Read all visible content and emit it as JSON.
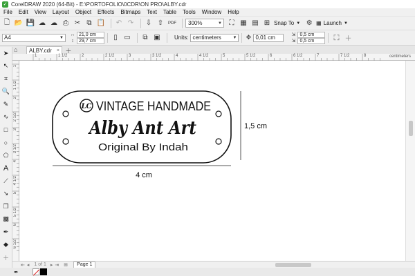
{
  "window": {
    "title": "CorelDRAW 2020 (64-Bit) - E:\\PORTOFOLIO\\0CDR\\ON PRO\\ALBY.cdr"
  },
  "menu": [
    "File",
    "Edit",
    "View",
    "Layout",
    "Object",
    "Effects",
    "Bitmaps",
    "Text",
    "Table",
    "Tools",
    "Window",
    "Help"
  ],
  "toolbar": {
    "zoom": "300%",
    "snap_label": "Snap To",
    "launch_label": "Launch"
  },
  "propbar": {
    "page_size": "A4",
    "width": "21,0 cm",
    "height": "29,7 cm",
    "units_label": "Units:",
    "units_value": "centimeters",
    "nudge": "0,01 cm",
    "dup_x": "0,5 cm",
    "dup_y": "0,5 cm"
  },
  "tabs": {
    "document": "ALBY.cdr"
  },
  "ruler": {
    "units": "centimeters",
    "h_labels": [
      "1",
      "1 1/2",
      "2",
      "2 1/2",
      "3",
      "3 1/2",
      "4",
      "4 1/2",
      "5",
      "5 1/2",
      "6",
      "6 1/2",
      "7",
      "7 1/2",
      "8"
    ],
    "v_labels": [
      "1",
      "1 1/2",
      "2",
      "2 1/2",
      "3",
      "3 1/2",
      "4",
      "4 1/2",
      "5",
      "5 1/2",
      "6",
      "6 1/2"
    ]
  },
  "design": {
    "monogram": "LC",
    "line1": "VINTAGE HANDMADE",
    "line2": "Alby Ant Art",
    "line3": "Original By Indah",
    "dim_width": "4 cm",
    "dim_height": "1,5 cm"
  },
  "pages": {
    "nav": "1 of 1",
    "page_tab": "Page 1"
  },
  "colors": {
    "accent": "#3aa13a",
    "chrome": "#f0f0f0"
  }
}
